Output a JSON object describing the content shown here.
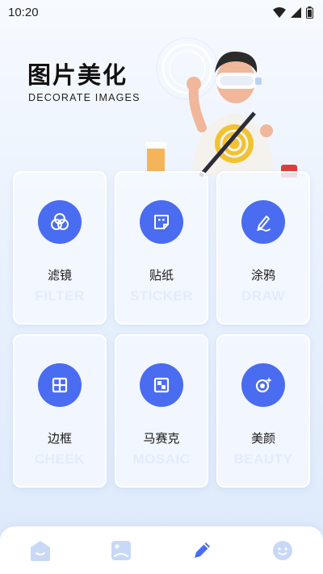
{
  "status_bar": {
    "time": "10:20"
  },
  "hero": {
    "title": "图片美化",
    "subtitle": "DECORATE IMAGES"
  },
  "tools": [
    {
      "label": "滤镜",
      "en": "FILTER",
      "icon": "filter-icon"
    },
    {
      "label": "贴纸",
      "en": "STICKER",
      "icon": "sticker-icon"
    },
    {
      "label": "涂鸦",
      "en": "DRAW",
      "icon": "draw-icon"
    },
    {
      "label": "边框",
      "en": "CHEEK",
      "icon": "frame-icon"
    },
    {
      "label": "马赛克",
      "en": "MOSAIC",
      "icon": "mosaic-icon"
    },
    {
      "label": "美颜",
      "en": "BEAUTY",
      "icon": "beauty-icon"
    }
  ],
  "bottom_nav": [
    {
      "icon": "home-icon",
      "active": false
    },
    {
      "icon": "gallery-icon",
      "active": false
    },
    {
      "icon": "edit-icon",
      "active": true
    },
    {
      "icon": "profile-icon",
      "active": false
    }
  ],
  "colors": {
    "accent": "#4a6cf0",
    "inactive_nav": "#c9d8f5",
    "card_en_text": "#e4ecfb"
  }
}
